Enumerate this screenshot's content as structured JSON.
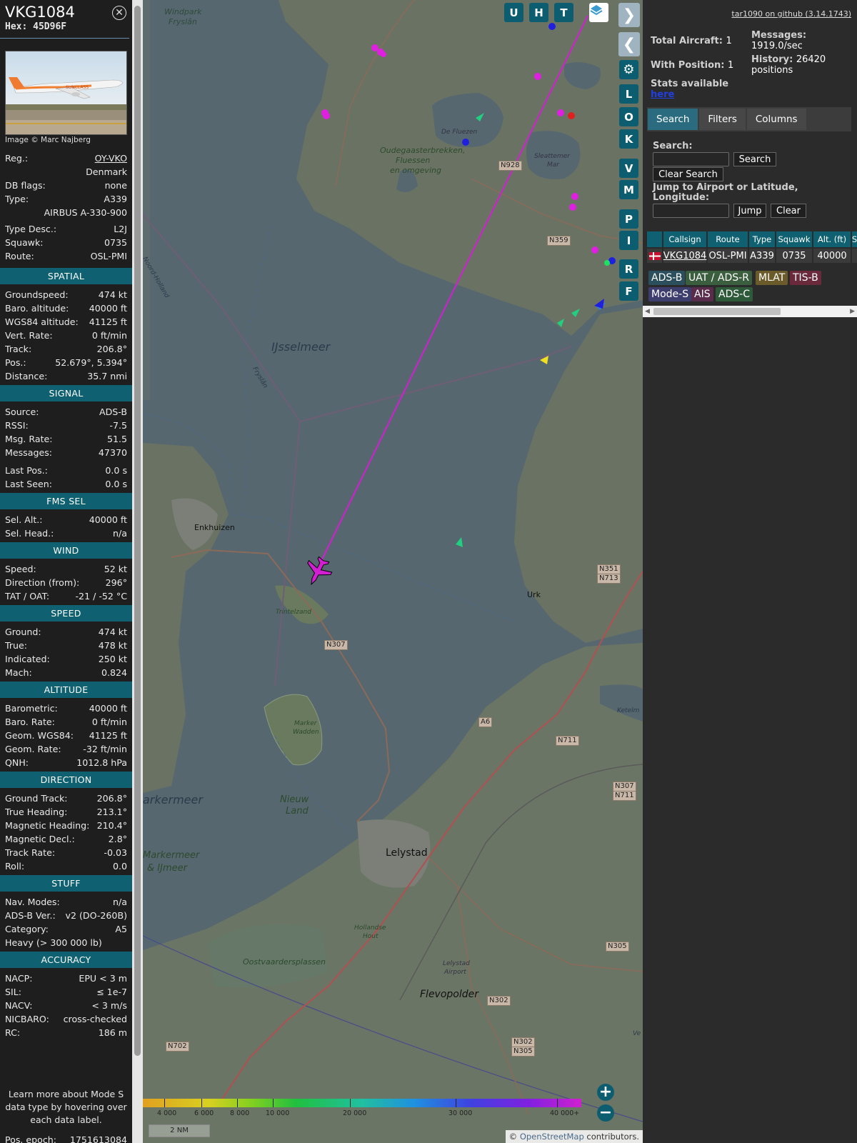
{
  "info": {
    "callsign": "VKG1084",
    "hex_label": "Hex:",
    "hex": "45D96F",
    "image_credit": "Image © Marc Najberg",
    "photo_text": "SUNCLASS",
    "general": [
      {
        "k": "Reg.:",
        "v": "OY-VKO"
      },
      {
        "k": "",
        "v": "Denmark"
      },
      {
        "k": "DB flags:",
        "v": "none"
      },
      {
        "k": "Type:",
        "v": "A339"
      },
      {
        "k": "",
        "v": "AIRBUS A-330-900"
      },
      {
        "k": "Type Desc.:",
        "v": "L2J"
      },
      {
        "k": "Squawk:",
        "v": "0735"
      },
      {
        "k": "Route:",
        "v": "OSL-PMI"
      }
    ],
    "sections": [
      {
        "title": "SPATIAL",
        "rows": [
          {
            "k": "Groundspeed:",
            "v": "474 kt"
          },
          {
            "k": "Baro. altitude:",
            "v": "40000 ft"
          },
          {
            "k": "WGS84 altitude:",
            "v": "41125 ft"
          },
          {
            "k": "Vert. Rate:",
            "v": "0 ft/min"
          },
          {
            "k": "Track:",
            "v": "206.8°"
          },
          {
            "k": "Pos.:",
            "v": "52.679°, 5.394°"
          },
          {
            "k": "Distance:",
            "v": "35.7 nmi"
          }
        ]
      },
      {
        "title": "SIGNAL",
        "rows": [
          {
            "k": "Source:",
            "v": "ADS-B"
          },
          {
            "k": "RSSI:",
            "v": "-7.5"
          },
          {
            "k": "Msg. Rate:",
            "v": "51.5"
          },
          {
            "k": "Messages:",
            "v": "47370"
          },
          {
            "k": "Last Pos.:",
            "v": "0.0 s"
          },
          {
            "k": "Last Seen:",
            "v": "0.0 s"
          }
        ]
      },
      {
        "title": "FMS SEL",
        "rows": [
          {
            "k": "Sel. Alt.:",
            "v": "40000 ft"
          },
          {
            "k": "Sel. Head.:",
            "v": "n/a"
          }
        ]
      },
      {
        "title": "WIND",
        "rows": [
          {
            "k": "Speed:",
            "v": "52 kt"
          },
          {
            "k": "Direction (from):",
            "v": "296°"
          },
          {
            "k": "TAT / OAT:",
            "v": "-21 / -52 °C"
          }
        ]
      },
      {
        "title": "SPEED",
        "rows": [
          {
            "k": "Ground:",
            "v": "474 kt"
          },
          {
            "k": "True:",
            "v": "478 kt"
          },
          {
            "k": "Indicated:",
            "v": "250 kt"
          },
          {
            "k": "Mach:",
            "v": "0.824"
          }
        ]
      },
      {
        "title": "ALTITUDE",
        "rows": [
          {
            "k": "Barometric:",
            "v": "40000 ft"
          },
          {
            "k": "Baro. Rate:",
            "v": "0 ft/min"
          },
          {
            "k": "Geom. WGS84:",
            "v": "41125 ft"
          },
          {
            "k": "Geom. Rate:",
            "v": "-32 ft/min"
          },
          {
            "k": "QNH:",
            "v": "1012.8 hPa"
          }
        ]
      },
      {
        "title": "DIRECTION",
        "rows": [
          {
            "k": "Ground Track:",
            "v": "206.8°"
          },
          {
            "k": "True Heading:",
            "v": "213.1°"
          },
          {
            "k": "Magnetic Heading:",
            "v": "210.4°"
          },
          {
            "k": "Magnetic Decl.:",
            "v": "2.8°"
          },
          {
            "k": "Track Rate:",
            "v": "-0.03"
          },
          {
            "k": "Roll:",
            "v": "0.0"
          }
        ]
      },
      {
        "title": "STUFF",
        "rows": [
          {
            "k": "Nav. Modes:",
            "v": "n/a"
          },
          {
            "k": "ADS-B Ver.:",
            "v": "v2 (DO-260B)"
          },
          {
            "k": "Category:",
            "v": "A5"
          },
          {
            "k": "Heavy (> 300 000 lb)",
            "v": ""
          }
        ]
      },
      {
        "title": "ACCURACY",
        "rows": [
          {
            "k": "NACP:",
            "v": "EPU < 3 m"
          },
          {
            "k": "SIL:",
            "v": "≤ 1e-7"
          },
          {
            "k": "NACV:",
            "v": "< 3 m/s"
          },
          {
            "k": "NICBARO:",
            "v": "cross-checked"
          },
          {
            "k": "RC:",
            "v": "186 m"
          }
        ]
      }
    ],
    "note": "Learn more about Mode S data type by hovering over each data label.",
    "pos_epoch_label": "Pos. epoch:",
    "pos_epoch": "1751613084"
  },
  "map": {
    "buttons_top": [
      "U",
      "H",
      "T"
    ],
    "buttons_side": [
      "L",
      "O",
      "K",
      "V",
      "M",
      "P",
      "I",
      "R",
      "F"
    ],
    "labels": {
      "windpark": "Windpark",
      "fryslan": "Fryslân",
      "oudega1": "Oudegaasterbrekken,",
      "oudega2": "Fluessen",
      "oudega3": "en omgeving",
      "fluezen1": "De Fluezen",
      "sleat1": "Sleattemer",
      "sleat2": "Mar",
      "noordholland": "Noord-Holland",
      "ijsselmeer": "IJsselmeer",
      "fryslan2": "Fryslân",
      "enkhuizen": "Enkhuizen",
      "urk": "Urk",
      "trintelzand": "Trintelzand",
      "markerwadden1": "Marker",
      "markerwadden2": "Wadden",
      "markermeer": "arkermeer",
      "nieuwland1": "Nieuw",
      "nieuwland2": "Land",
      "markermeerij1": "Markermeer",
      "markermeerij2": "& IJmeer",
      "lelystad": "Lelystad",
      "hollandsehout1": "Hollandse",
      "hollandsehout2": "Hout",
      "oostvaarders": "Oostvaardersplassen",
      "lelystadap1": "Lelystad",
      "lelystadap2": "Airport",
      "flevopolder": "Flevopolder",
      "ketelmeer": "Ketelm",
      "ve": "Ve"
    },
    "road_labels": [
      "N928",
      "N359",
      "N307",
      "N351",
      "N713",
      "A6",
      "N711",
      "N307",
      "N711",
      "N305",
      "N302",
      "N302",
      "N305",
      "N702"
    ],
    "altitude_ticks": [
      "4 000",
      "6 000",
      "8 000",
      "10 000",
      "20 000",
      "30 000",
      "40 000+"
    ],
    "scale": "2 NM",
    "attribution_prefix": "© ",
    "attribution_osm": "OpenStreetMap",
    "attribution_suffix": " contributors."
  },
  "sidebar": {
    "github": "tar1090 on github (3.14.1743)",
    "total_aircraft_label": "Total Aircraft:",
    "total_aircraft": "1",
    "with_position_label": "With Position:",
    "with_position": "1",
    "messages_label": "Messages:",
    "messages": "1919.0/sec",
    "history_label": "History:",
    "history": "26420",
    "history_unit": "positions",
    "stats_label": "Stats available",
    "stats_link": "here",
    "tabs": [
      "Search",
      "Filters",
      "Columns"
    ],
    "search_label": "Search:",
    "search_btn": "Search",
    "clear_search_btn": "Clear Search",
    "jump_label": "Jump to Airport or Latitude, Longitude:",
    "jump_btn": "Jump",
    "clear_btn": "Clear",
    "table_headers": [
      "",
      "Callsign",
      "Route",
      "Type",
      "Squawk",
      "Alt. (ft)",
      "S"
    ],
    "table_row": {
      "callsign": "VKG1084",
      "route": "OSL-PMI",
      "type": "A339",
      "squawk": "0735",
      "alt": "40000"
    },
    "sources": [
      {
        "label": "ADS-B",
        "bg": "#2b4f5c"
      },
      {
        "label": "UAT / ADS-R",
        "bg": "#3a5e3e"
      },
      {
        "label": "MLAT",
        "bg": "#6b5a2a"
      },
      {
        "label": "TIS-B",
        "bg": "#6a2a3c"
      },
      {
        "label": "Mode-S",
        "bg": "#3e3e6e"
      },
      {
        "label": "AIS",
        "bg": "#5a2c4c"
      },
      {
        "label": "ADS-C",
        "bg": "#2f5a3a"
      }
    ]
  },
  "colors": {
    "track": "#d21fd2",
    "aircraft": "#d21fd2",
    "section": "#0f6172"
  }
}
